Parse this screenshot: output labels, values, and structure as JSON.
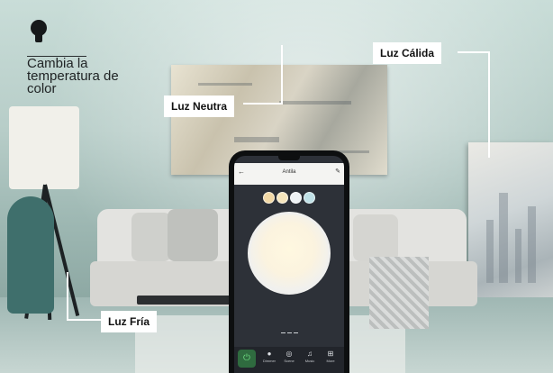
{
  "headline": {
    "icon": "lightbulb-icon",
    "text": "Cambia la temperatura de color"
  },
  "labels": {
    "neutral": "Luz Neutra",
    "warm": "Luz Cálida",
    "cold": "Luz Fría"
  },
  "app": {
    "title": "Antila",
    "back_icon": "back-arrow-icon",
    "edit_icon": "edit-pencil-icon",
    "swatch_colors": [
      "#f2d9a6",
      "#f6e6bd",
      "#eef2f4",
      "#bfe0e6"
    ],
    "nav": [
      {
        "label": "Dimmer",
        "icon": "bulb-icon"
      },
      {
        "label": "Scene",
        "icon": "scene-icon"
      },
      {
        "label": "Music",
        "icon": "music-icon"
      },
      {
        "label": "More",
        "icon": "grid-icon"
      }
    ],
    "power_icon": "power-icon"
  }
}
